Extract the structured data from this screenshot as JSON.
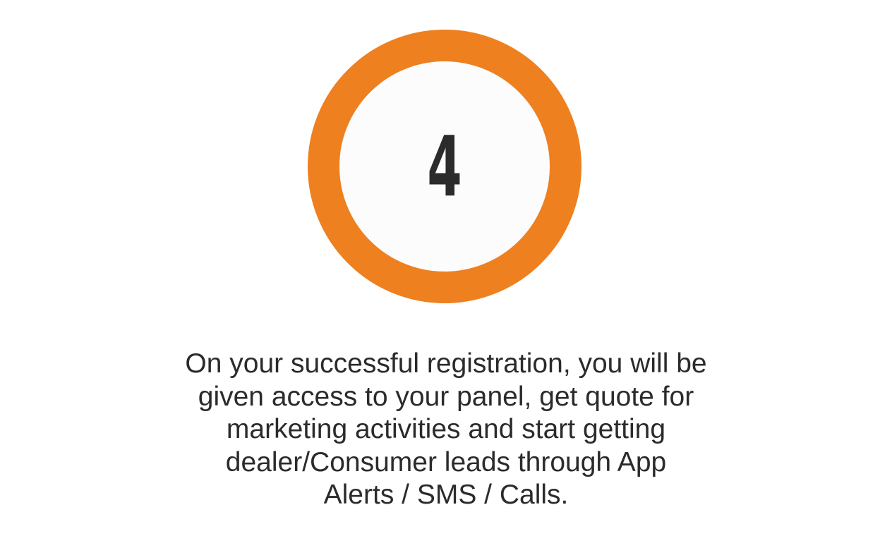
{
  "step": {
    "number": "4",
    "ring_color": "#ee801f",
    "description_lines": [
      "On your successful registration, you will be",
      "given access to your panel, get quote for",
      "marketing activities and start getting",
      "dealer/Consumer leads through App",
      "Alerts / SMS / Calls."
    ]
  }
}
